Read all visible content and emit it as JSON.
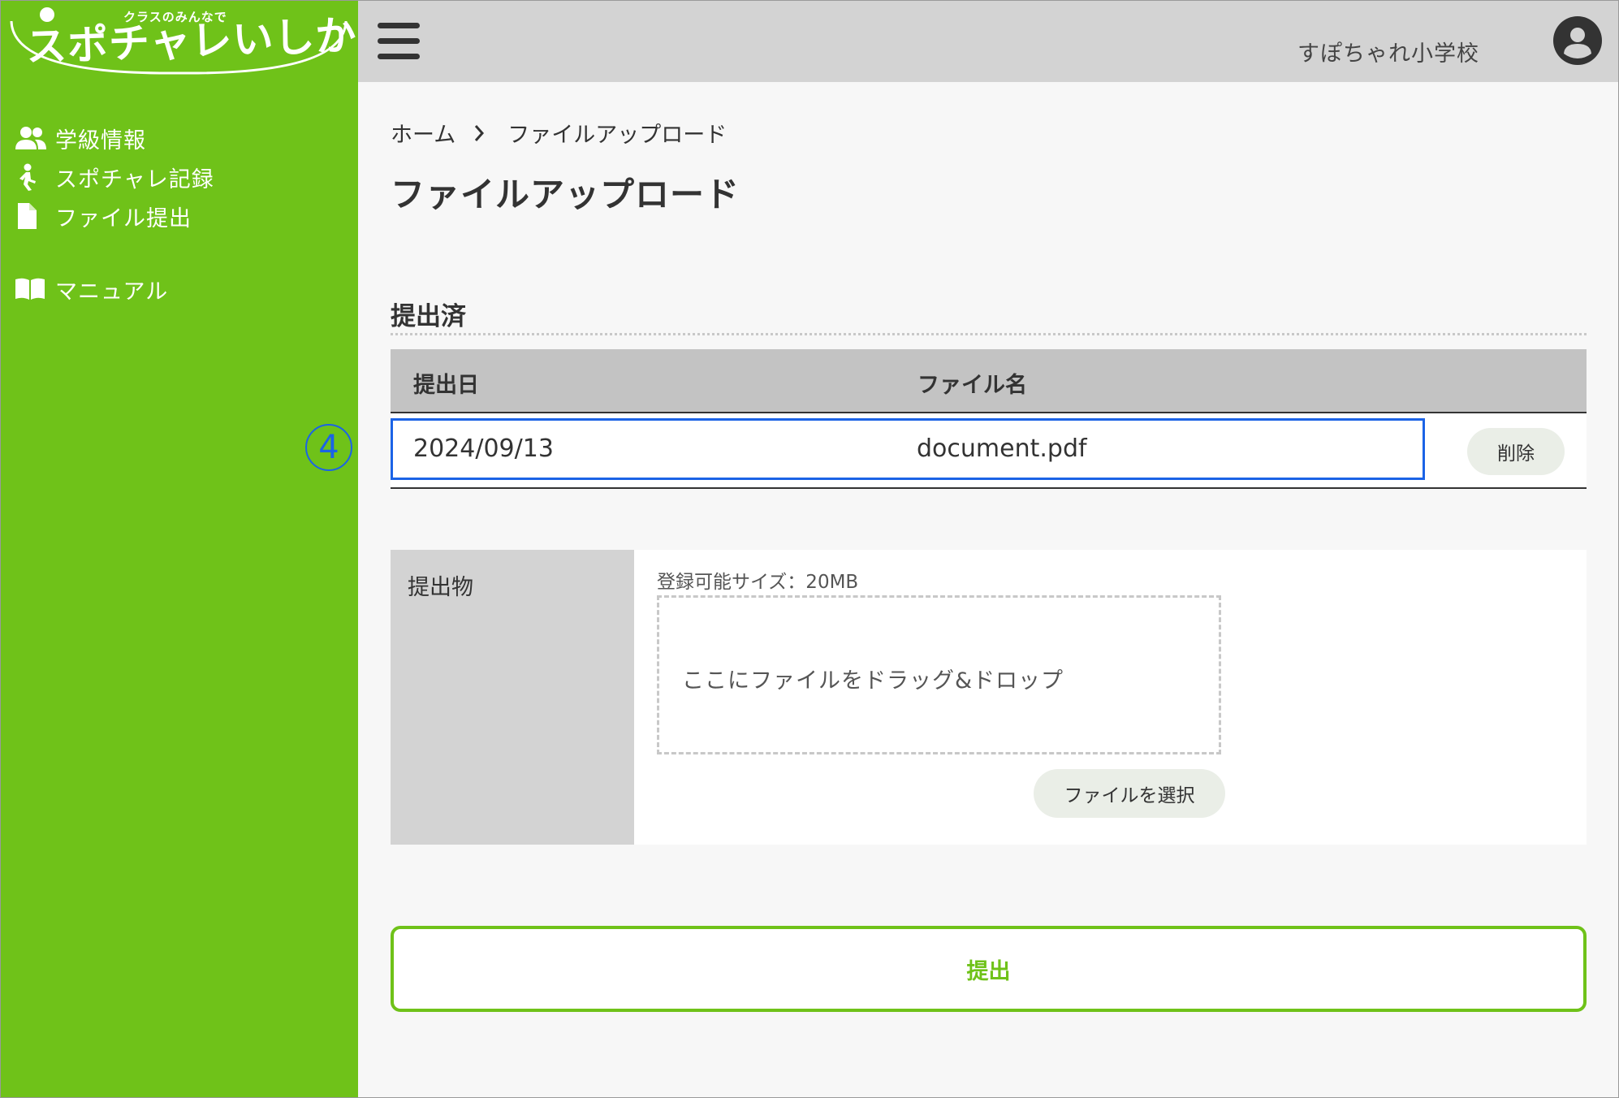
{
  "brand": {
    "tagline": "クラスのみんなで",
    "name": "スポチャレいしかわ"
  },
  "sidebar": {
    "items": [
      {
        "label": "学級情報",
        "icon": "users-icon"
      },
      {
        "label": "スポチャレ記録",
        "icon": "walking-icon"
      },
      {
        "label": "ファイル提出",
        "icon": "file-icon"
      },
      {
        "label": "マニュアル",
        "icon": "book-icon"
      }
    ]
  },
  "header": {
    "school_name": "すぽちゃれ小学校",
    "menu_icon": "hamburger-icon",
    "account_icon": "account-icon"
  },
  "breadcrumb": {
    "home": "ホーム",
    "current": "ファイルアップロード"
  },
  "page_title": "ファイルアップロード",
  "submitted": {
    "title": "提出済",
    "columns": [
      "提出日",
      "ファイル名"
    ],
    "rows": [
      {
        "date": "2024/09/13",
        "filename": "document.pdf",
        "delete_label": "削除"
      }
    ]
  },
  "annotation": {
    "marker": "4"
  },
  "upload": {
    "label": "提出物",
    "size_note": "登録可能サイズ：20MB",
    "dropzone_text": "ここにファイルをドラッグ&ドロップ",
    "select_label": "ファイルを選択"
  },
  "submit_label": "提出",
  "colors": {
    "sidebar": "#6fc219",
    "header": "#d3d3d3",
    "highlight": "#1b63e6",
    "accent": "#6fc219"
  }
}
